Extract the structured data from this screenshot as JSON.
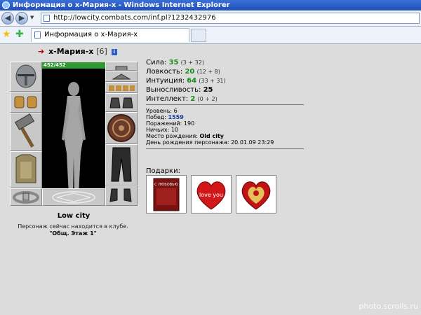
{
  "window": {
    "title": "Информация о x-Мария-x - Windows Internet Explorer",
    "url": "http://lowcity.combats.com/inf.pl?1232432976",
    "tab_label": "Информация о x-Мария-x"
  },
  "character": {
    "name": "x-Мария-x",
    "level": "[6]",
    "hp": "452/452",
    "city": "Low city",
    "location_text": "Персонаж сейчас находится в клубе.",
    "location_room": "\"Общ. Этаж 1\""
  },
  "stats": [
    {
      "label": "Сила:",
      "value": "35",
      "bonus": "(3 + 32)"
    },
    {
      "label": "Ловкость:",
      "value": "20",
      "bonus": "(12 + 8)"
    },
    {
      "label": "Интуиция:",
      "value": "64",
      "bonus": "(33 + 31)"
    },
    {
      "label": "Выносливость:",
      "value": "25",
      "bonus": ""
    },
    {
      "label": "Интеллект:",
      "value": "2",
      "bonus": "(0 + 2)"
    }
  ],
  "info": {
    "level_label": "Уровень:",
    "level_value": "6",
    "wins_label": "Побед:",
    "wins_value": "1559",
    "losses_label": "Поражений:",
    "losses_value": "190",
    "draws_label": "Ничьих:",
    "draws_value": "10",
    "birthplace_label": "Место рождения:",
    "birthplace_value": "Old city",
    "birthday_label": "День рождения персонажа:",
    "birthday_value": "20.01.09 23:29"
  },
  "gifts": {
    "label": "Подарки:",
    "gift1_text": "С ЛЮБОВЬЮ",
    "gift2_text": "love you"
  },
  "watermark": "photo.scrolls.ru",
  "colors": {
    "stat_value": "#1a8b1a",
    "wins_value": "#1a3aa0",
    "hp_bar": "#2f9a2f",
    "page_bg": "#dcdcdc"
  }
}
